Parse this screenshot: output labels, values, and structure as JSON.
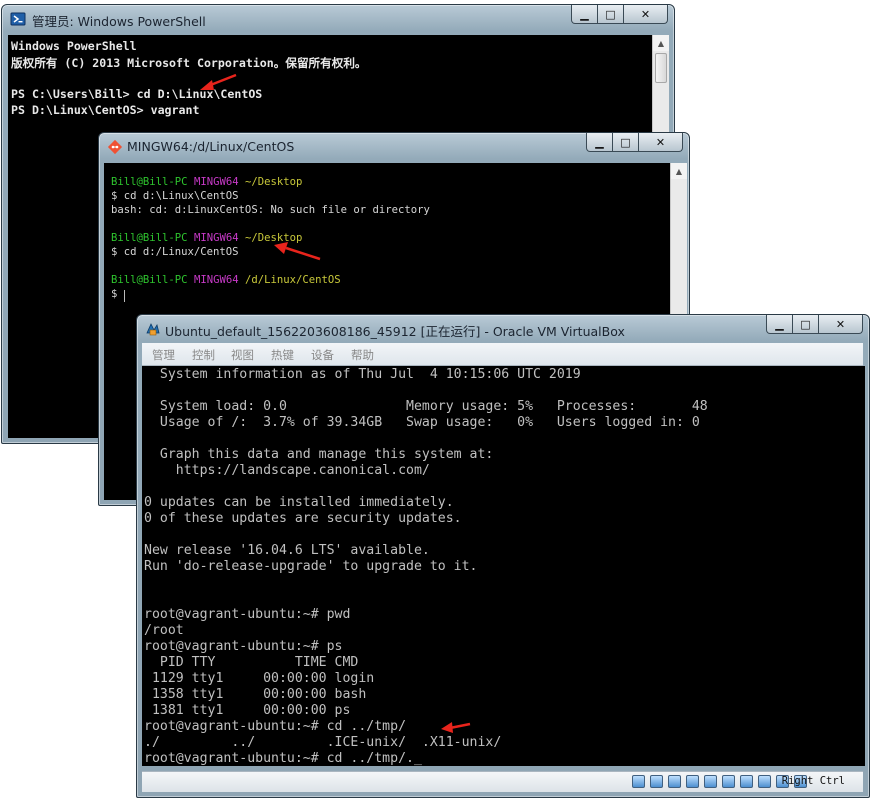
{
  "powershell": {
    "title": "管理员: Windows PowerShell",
    "lines": [
      "Windows PowerShell",
      "版权所有 (C) 2013 Microsoft Corporation。保留所有权利。",
      "",
      "PS C:\\Users\\Bill> cd D:\\Linux\\CentOS",
      "PS D:\\Linux\\CentOS> vagrant"
    ]
  },
  "mingw": {
    "title": "MINGW64:/d/Linux/CentOS",
    "lines": [
      {
        "user": "Bill@Bill-PC",
        "sys": "MINGW64",
        "path": "~/Desktop"
      },
      {
        "text": "$ cd d:\\Linux\\CentOS"
      },
      {
        "text": "bash: cd: d:LinuxCentOS: No such file or directory"
      },
      {
        "user": "Bill@Bill-PC",
        "sys": "MINGW64",
        "path": "~/Desktop"
      },
      {
        "text": "$ cd d:/Linux/CentOS"
      },
      {
        "user": "Bill@Bill-PC",
        "sys": "MINGW64",
        "path": "/d/Linux/CentOS"
      },
      {
        "text": "$ "
      }
    ]
  },
  "vbox": {
    "title": "Ubuntu_default_1562203608186_45912 [正在运行] - Oracle VM VirtualBox",
    "menu": [
      "管理",
      "控制",
      "视图",
      "热键",
      "设备",
      "帮助"
    ],
    "host_key": "Right Ctrl",
    "lines": [
      "  System information as of Thu Jul  4 10:15:06 UTC 2019",
      "",
      "  System load: 0.0               Memory usage: 5%   Processes:       48",
      "  Usage of /:  3.7% of 39.34GB   Swap usage:   0%   Users logged in: 0",
      "",
      "  Graph this data and manage this system at:",
      "    https://landscape.canonical.com/",
      "",
      "0 updates can be installed immediately.",
      "0 of these updates are security updates.",
      "",
      "New release '16.04.6 LTS' available.",
      "Run 'do-release-upgrade' to upgrade to it.",
      "",
      "",
      "root@vagrant-ubuntu:~# pwd",
      "/root",
      "root@vagrant-ubuntu:~# ps",
      "  PID TTY          TIME CMD",
      " 1129 tty1     00:00:00 login",
      " 1358 tty1     00:00:00 bash",
      " 1381 tty1     00:00:00 ps",
      "root@vagrant-ubuntu:~# cd ../tmp/",
      "./         ../         .ICE-unix/  .X11-unix/",
      "root@vagrant-ubuntu:~# cd ../tmp/._"
    ]
  },
  "colors": {
    "annotation_arrow": "#e8241c",
    "prompt_green": "#2ec42e",
    "prompt_magenta": "#c83ac8",
    "prompt_yellow": "#c8c83a"
  },
  "icons": [
    "powershell-icon",
    "git-bash-icon",
    "virtualbox-icon",
    "minimize-icon",
    "maximize-icon",
    "close-icon"
  ]
}
